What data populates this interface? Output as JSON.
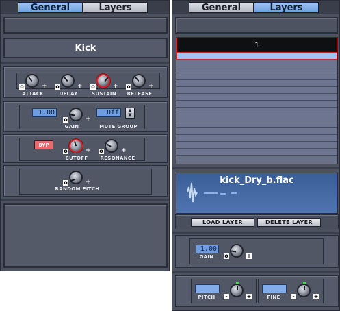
{
  "tabs": {
    "general": "General",
    "layers": "Layers"
  },
  "instrument": {
    "name": "Kick"
  },
  "envelope": {
    "attack_label": "ATTACK",
    "decay_label": "DECAY",
    "sustain_label": "SUSTAIN",
    "release_label": "RELEASE"
  },
  "gain_section": {
    "gain_value": "1.00",
    "gain_label": "GAIN",
    "mute_group_value": "Off",
    "mute_group_label": "MUTE GROUP"
  },
  "filter": {
    "bypass_label": "BYP",
    "cutoff_label": "CUTOFF",
    "resonance_label": "RESONANCE"
  },
  "random_pitch": {
    "label": "RANDOM PITCH"
  },
  "knob_symbols": {
    "min": "o",
    "max": "+"
  },
  "layers": {
    "header": "1",
    "sample_name": "kick_Dry_b.flac",
    "load_button": "LOAD LAYER",
    "delete_button": "DELETE LAYER",
    "gain_value": "1.00",
    "gain_label": "GAIN",
    "pitch_label": "PITCH",
    "fine_label": "FINE",
    "pitch_minus": "-",
    "pitch_plus": "+"
  },
  "colors": {
    "accent_tab": "#7aaae6",
    "knob_active_ring": "#d0262a",
    "lcd": "#6d9de0",
    "bypass": "#e86a6c"
  }
}
